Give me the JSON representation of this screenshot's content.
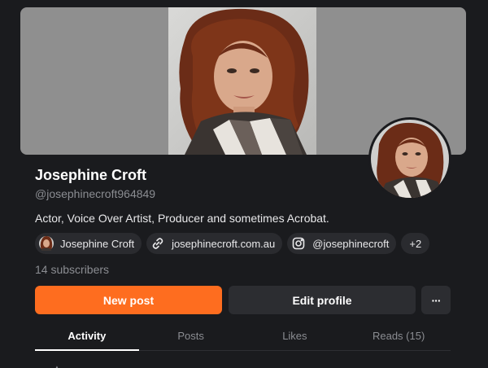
{
  "profile": {
    "name": "Josephine Croft",
    "handle": "@josephinecroft964849",
    "bio": "Actor, Voice Over Artist, Producer and sometimes Acrobat.",
    "subscribers": "14 subscribers"
  },
  "links": [
    {
      "label": "Josephine Croft",
      "icon": "avatar-icon"
    },
    {
      "label": "josephinecroft.com.au",
      "icon": "link-icon"
    },
    {
      "label": "@josephinecroft",
      "icon": "instagram-icon"
    },
    {
      "label": "+2"
    }
  ],
  "actions": {
    "new_post": "New post",
    "edit_profile": "Edit profile",
    "more": "···"
  },
  "tabs": [
    {
      "label": "Activity",
      "active": true
    },
    {
      "label": "Posts",
      "active": false
    },
    {
      "label": "Likes",
      "active": false
    },
    {
      "label": "Reads (15)",
      "active": false
    }
  ],
  "colors": {
    "background": "#1a1b1e",
    "accent": "#fe6d1f",
    "secondary_button": "#2c2d31",
    "muted_text": "#8b8d92",
    "cover_gray": "#8f8f8f"
  }
}
